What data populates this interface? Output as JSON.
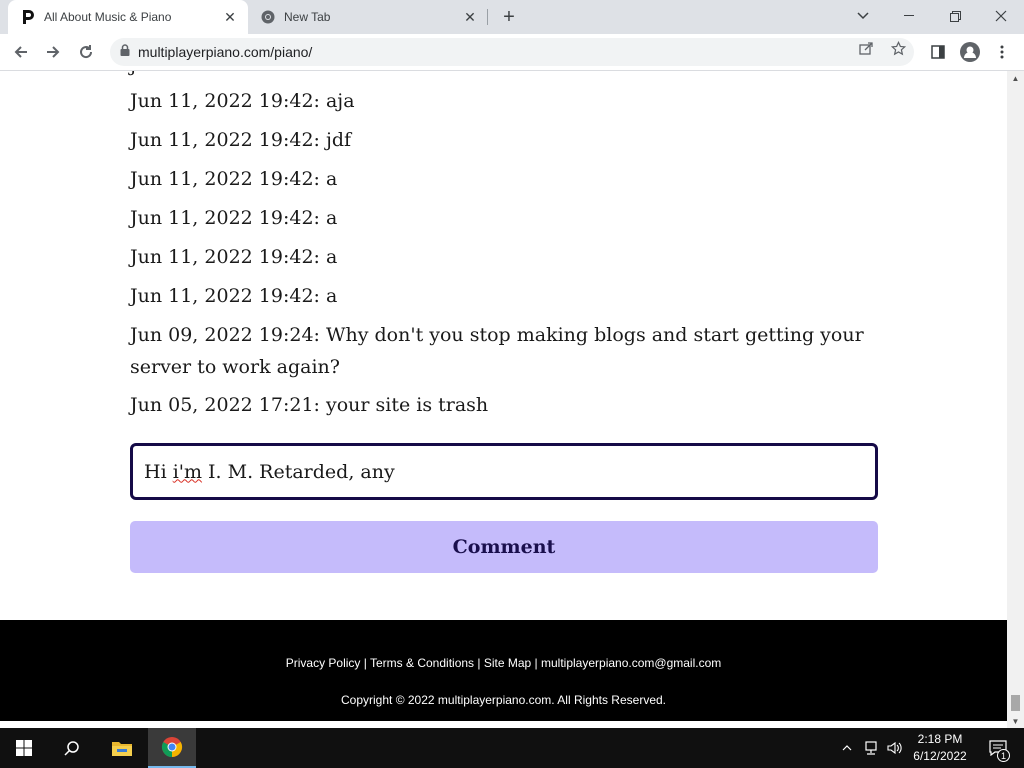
{
  "browser": {
    "tabs": [
      {
        "title": "All About Music & Piano",
        "active": true,
        "favicon": "piano-logo-icon"
      },
      {
        "title": "New Tab",
        "active": false,
        "favicon": "chrome-icon"
      }
    ],
    "url": "multiplayerpiano.com/piano/"
  },
  "comments": [
    {
      "text": "Jun 11, 2022 19:42: aja"
    },
    {
      "text": "Jun 11, 2022 19:42: jdf"
    },
    {
      "text": "Jun 11, 2022 19:42: a"
    },
    {
      "text": "Jun 11, 2022 19:42: a"
    },
    {
      "text": "Jun 11, 2022 19:42: a"
    },
    {
      "text": "Jun 11, 2022 19:42: a"
    },
    {
      "text": "Jun 09, 2022 19:24: Why don't you stop making blogs and start getting your server to work again?"
    },
    {
      "text": "Jun 05, 2022 17:21: your site is trash"
    }
  ],
  "partial_comment": "j",
  "comment_form": {
    "value_prefix": "Hi ",
    "value_misspelled": "i'm",
    "value_suffix": " I. M. Retarded, any",
    "button_label": "Comment"
  },
  "footer": {
    "links": [
      "Privacy Policy",
      "Terms & Conditions",
      "Site Map",
      "multiplayerpiano.com@gmail.com"
    ],
    "separator": " | ",
    "copyright": "Copyright © 2022 multiplayerpiano.com. All Rights Reserved."
  },
  "taskbar": {
    "time": "2:18 PM",
    "date": "6/12/2022",
    "notifications": "1"
  },
  "colors": {
    "input_border": "#150a47",
    "button_bg": "#c5bbfb",
    "button_text": "#1a0f4d",
    "footer_bg": "#000000"
  }
}
